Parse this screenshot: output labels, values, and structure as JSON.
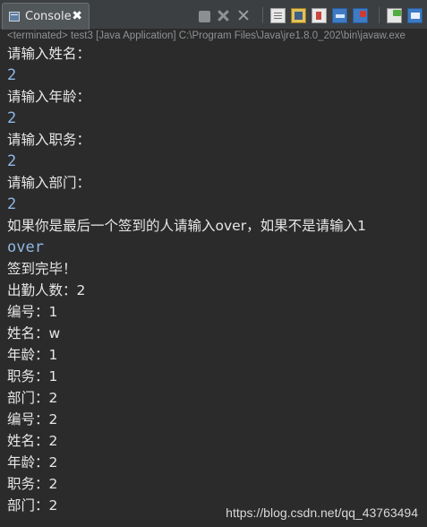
{
  "tab": {
    "label": "Console",
    "close": "✖"
  },
  "toolbar": {
    "items": [
      "stop-icon",
      "remove-icon",
      "remove-all-icon",
      "clear-console-icon",
      "scroll-lock-icon",
      "word-wrap-icon",
      "show-when-stdout-icon",
      "show-when-stderr-icon",
      "pin-console-icon",
      "display-console-icon",
      "dropdown-icon"
    ]
  },
  "status": "<terminated> test3 [Java Application] C:\\Program Files\\Java\\jre1.8.0_202\\bin\\javaw.exe",
  "console_lines": [
    {
      "text": "请输入姓名：",
      "type": "output"
    },
    {
      "text": "2",
      "type": "input"
    },
    {
      "text": "请输入年龄：",
      "type": "output"
    },
    {
      "text": "2",
      "type": "input"
    },
    {
      "text": "请输入职务：",
      "type": "output"
    },
    {
      "text": "2",
      "type": "input"
    },
    {
      "text": "请输入部门：",
      "type": "output"
    },
    {
      "text": "2",
      "type": "input"
    },
    {
      "text": "如果你是最后一个签到的人请输入over，如果不是请输入1",
      "type": "output"
    },
    {
      "text": "over",
      "type": "input"
    },
    {
      "text": "签到完毕！",
      "type": "output"
    },
    {
      "text": "出勤人数：2",
      "type": "output"
    },
    {
      "text": "编号：1",
      "type": "output"
    },
    {
      "text": "姓名：w",
      "type": "output"
    },
    {
      "text": "年龄：1",
      "type": "output"
    },
    {
      "text": "职务：1",
      "type": "output"
    },
    {
      "text": "部门：2",
      "type": "output"
    },
    {
      "text": "编号：2",
      "type": "output"
    },
    {
      "text": "姓名：2",
      "type": "output"
    },
    {
      "text": "年龄：2",
      "type": "output"
    },
    {
      "text": "职务：2",
      "type": "output"
    },
    {
      "text": "部门：2",
      "type": "output"
    }
  ],
  "watermark": "https://blog.csdn.net/qq_43763494",
  "colors": {
    "background": "#2b2b2b",
    "output_text": "#e6e6e6",
    "input_text": "#8fb8e6",
    "status_text": "#8d9296"
  }
}
